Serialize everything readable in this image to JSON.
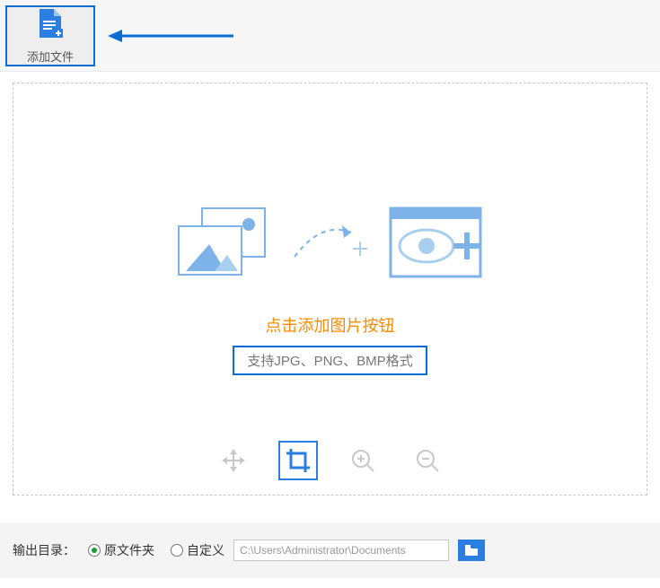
{
  "toolbar": {
    "add_file_label": "添加文件"
  },
  "dropzone": {
    "main_text": "点击添加图片按钮",
    "sub_text": "支持JPG、PNG、BMP格式"
  },
  "footer": {
    "output_label": "输出目录：",
    "radio_original": "原文件夹",
    "radio_custom": "自定义",
    "path_value": "C:\\Users\\Administrator\\Documents"
  }
}
